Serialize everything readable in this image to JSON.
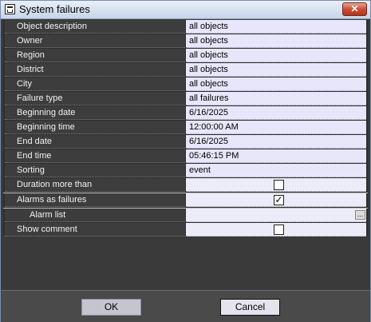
{
  "window": {
    "title": "System failures",
    "close_glyph": "✕"
  },
  "rows": [
    {
      "label": "Object description",
      "value": "all objects"
    },
    {
      "label": "Owner",
      "value": "all objects"
    },
    {
      "label": "Region",
      "value": "all objects"
    },
    {
      "label": "District",
      "value": "all objects"
    },
    {
      "label": "City",
      "value": "all objects"
    },
    {
      "label": "Failure type",
      "value": "all failures"
    },
    {
      "label": "Beginning date",
      "value": "6/16/2025"
    },
    {
      "label": "Beginning time",
      "value": "12:00:00 AM"
    },
    {
      "label": "End date",
      "value": "6/16/2025"
    },
    {
      "label": "End time",
      "value": "05:46:15 PM"
    },
    {
      "label": "Sorting",
      "value": "event"
    },
    {
      "label": "Duration more than",
      "checked": false
    },
    {
      "label": "Alarms as failures",
      "checked": true
    },
    {
      "label": "Alarm list",
      "button_glyph": "..."
    },
    {
      "label": "Show comment",
      "checked": false
    }
  ],
  "check_glyph": "✓",
  "buttons": {
    "ok": "OK",
    "cancel": "Cancel"
  },
  "icons": {
    "app": "window-icon",
    "close": "close-icon"
  }
}
